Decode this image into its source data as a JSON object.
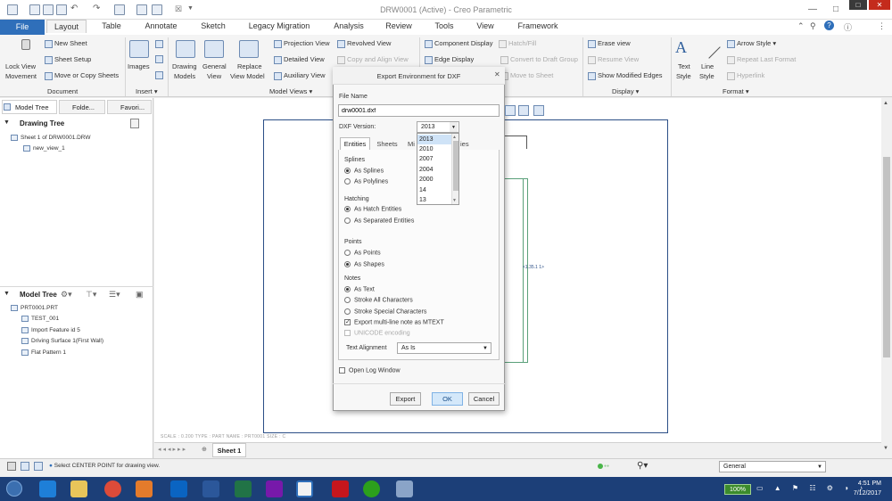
{
  "window": {
    "title": "DRW0001 (Active) - Creo Parametric",
    "controls": [
      "—",
      "□",
      "✕"
    ]
  },
  "menu": {
    "file": "File",
    "tabs": [
      "Layout",
      "Table",
      "Annotate",
      "Sketch",
      "Legacy Migration",
      "Analysis",
      "Review",
      "Tools",
      "View",
      "Framework"
    ],
    "active_tab": "Layout"
  },
  "ribbon": {
    "lock_view": [
      "Lock View",
      "Movement"
    ],
    "document": {
      "new_sheet": "New Sheet",
      "sheet_setup": "Sheet Setup",
      "move_copy": "Move or Copy Sheets",
      "label": "Document"
    },
    "insert": {
      "images": "Images",
      "label": "Insert"
    },
    "drawing_models": [
      "Drawing",
      "Models"
    ],
    "general_view": [
      "General",
      "View"
    ],
    "replace": [
      "Replace",
      "View Model"
    ],
    "views_col1": {
      "projection": "Projection View",
      "detailed": "Detailed View",
      "auxiliary": "Auxiliary View"
    },
    "views_col2": {
      "revolved": "Revolved View",
      "copy_align": "Copy and Align View"
    },
    "model_views_label": "Model Views",
    "display1": {
      "component": "Component Display",
      "edge": "Edge Display",
      "hatch": "Hatch/Fill",
      "convert": "Convert to Draft Group",
      "move": "Move to Sheet"
    },
    "display2": {
      "erase": "Erase view",
      "resume": "Resume View",
      "show_modified": "Show Modified Edges",
      "label": "Display"
    },
    "format": {
      "text_style": [
        "Text",
        "Style"
      ],
      "line_style": [
        "Line",
        "Style"
      ],
      "arrow_style": "Arrow Style",
      "repeat": "Repeat Last Format",
      "hyperlink": "Hyperlink",
      "label": "Format"
    }
  },
  "left_panel": {
    "tabs": [
      "Model Tree",
      "Folde...",
      "Favori..."
    ],
    "drawing_tree_header": "Drawing Tree",
    "drawing_tree_items": [
      "Sheet 1 of DRW0001.DRW",
      "new_view_1"
    ],
    "model_tree_header": "Model Tree",
    "model_tree_items": [
      "PRT0001.PRT",
      "TEST_001",
      "Import Feature id 5",
      "Driving Surface 1(First Wall)",
      "Flat Pattern 1"
    ]
  },
  "canvas": {
    "scale_text": "SCALE : 0.200   TYPE : PART   NAME : PRT0001   SIZE : C",
    "sheet_tab": "Sheet 1",
    "annotation": "<1.35.1 1>"
  },
  "status": {
    "message": "Select CENTER POINT for drawing view.",
    "filter": "General"
  },
  "taskbar": {
    "battery": "100%",
    "time": "4:51 PM",
    "date": "7/12/2017"
  },
  "dialog": {
    "title": "Export Environment for DXF",
    "file_name_label": "File Name",
    "file_name_value": "drw0001.dxf",
    "dxf_version_label": "DXF Version:",
    "dxf_version_value": "2013",
    "dxf_versions": [
      "2013",
      "2010",
      "2007",
      "2004",
      "2000",
      "14",
      "13"
    ],
    "tabs": [
      "Entities",
      "Sheets",
      "Mi",
      "ies"
    ],
    "splines": {
      "label": "Splines",
      "as_splines": "As Splines",
      "as_polylines": "As Polylines"
    },
    "hatching": {
      "label": "Hatching",
      "as_hatch": "As Hatch Entities",
      "as_separated": "As Separated Entities"
    },
    "points": {
      "label": "Points",
      "as_points": "As Points",
      "as_shapes": "As Shapes"
    },
    "notes": {
      "label": "Notes",
      "as_text": "As Text",
      "stroke_all": "Stroke All Characters",
      "stroke_special": "Stroke Special Characters",
      "mtext": "Export multi-line note as MTEXT",
      "unicode": "UNICODE encoding"
    },
    "text_alignment_label": "Text Alignment",
    "text_alignment_value": "As Is",
    "open_log": "Open Log Window",
    "buttons": {
      "export": "Export",
      "ok": "OK",
      "cancel": "Cancel"
    }
  },
  "colors": {
    "accent": "#2f6fba",
    "taskbar": "#1c3f78",
    "sheet_border": "#2b4e86"
  }
}
